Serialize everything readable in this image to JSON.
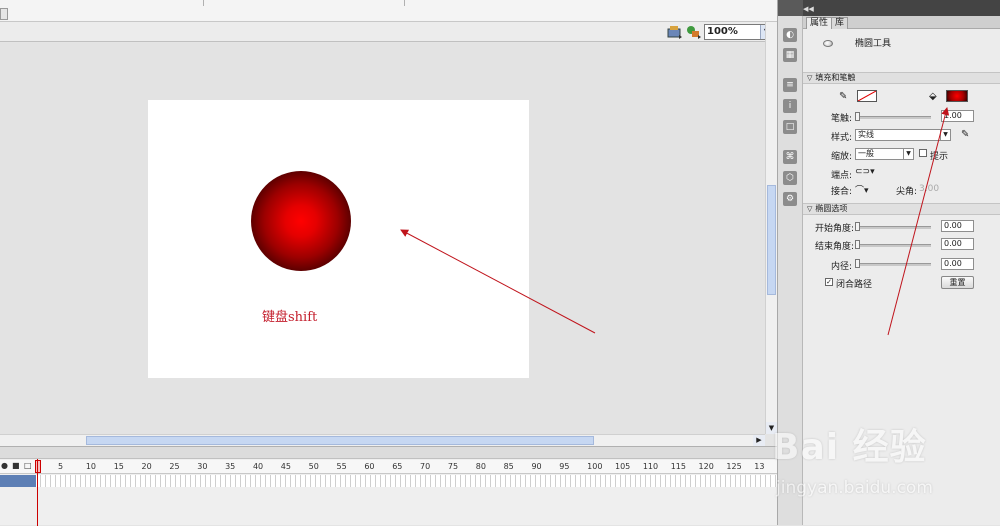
{
  "stage_toolbar": {
    "zoom_value": "100%",
    "icons": [
      "edit-scene-icon",
      "edit-symbols-icon"
    ]
  },
  "stage": {
    "caption": "键盘shift",
    "circle_fill": [
      "#ff0000",
      "#0d0000"
    ]
  },
  "timeline": {
    "frame_numbers": [
      "5",
      "10",
      "15",
      "20",
      "25",
      "30",
      "35",
      "40",
      "45",
      "50",
      "55",
      "60",
      "65",
      "70",
      "75",
      "80",
      "85",
      "90",
      "95",
      "100",
      "105",
      "110",
      "115",
      "120",
      "125",
      "13"
    ],
    "header_icons": [
      "eye-icon",
      "lock-icon",
      "outline-icon"
    ]
  },
  "properties_panel": {
    "tabs": [
      {
        "label": "属性",
        "active": true
      },
      {
        "label": "库",
        "active": false
      }
    ],
    "tool_name": "椭圆工具",
    "fill_stroke": {
      "section_title": "填充和笔触",
      "stroke_color": "none",
      "fill_color": "#cc0000",
      "stroke_label": "笔触:",
      "stroke_value": "1.00",
      "style_label": "样式:",
      "style_value": "实线",
      "scale_label": "缩放:",
      "scale_value": "一般",
      "hint_label": "提示",
      "cap_label": "端点:",
      "join_label": "接合:",
      "miter_label": "尖角:",
      "miter_value": "3.00"
    },
    "oval_options": {
      "section_title": "椭圆选项",
      "start_angle_label": "开始角度:",
      "start_angle_value": "0.00",
      "end_angle_label": "结束角度:",
      "end_angle_value": "0.00",
      "inner_radius_label": "内径:",
      "inner_radius_value": "0.00",
      "close_path_label": "闭合路径",
      "close_path_checked": true,
      "reset_label": "重置"
    }
  },
  "watermark": {
    "brand": "Bai 经验",
    "url": "jingyan.baidu.com"
  }
}
